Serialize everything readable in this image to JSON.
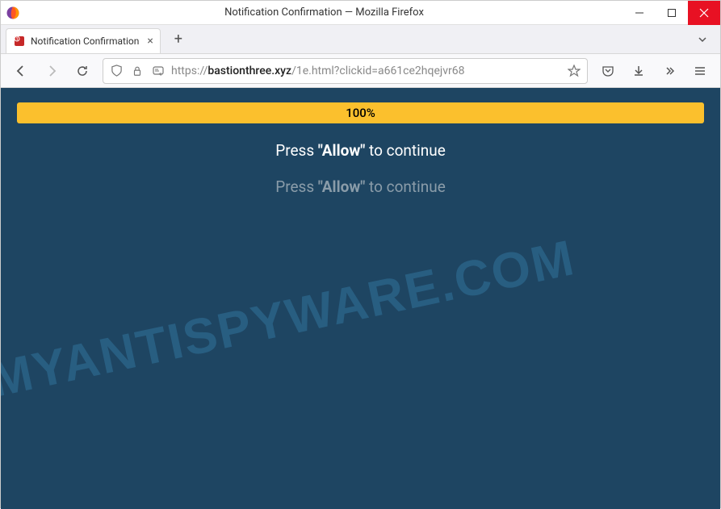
{
  "window": {
    "title": "Notification Confirmation — Mozilla Firefox"
  },
  "tab": {
    "label": "Notification Confirmation"
  },
  "url": {
    "protocol": "https://",
    "domain": "bastionthree.xyz",
    "path": "/1e.html?clickid=a661ce2hqejvr68"
  },
  "page": {
    "progress": "100%",
    "msg1_pre": "Press ",
    "msg1_bold": "\"Allow\"",
    "msg1_post": " to continue",
    "msg2_pre": "Press ",
    "msg2_bold": "\"Allow\"",
    "msg2_post": " to continue"
  },
  "watermark": "MYANTISPYWARE.COM"
}
